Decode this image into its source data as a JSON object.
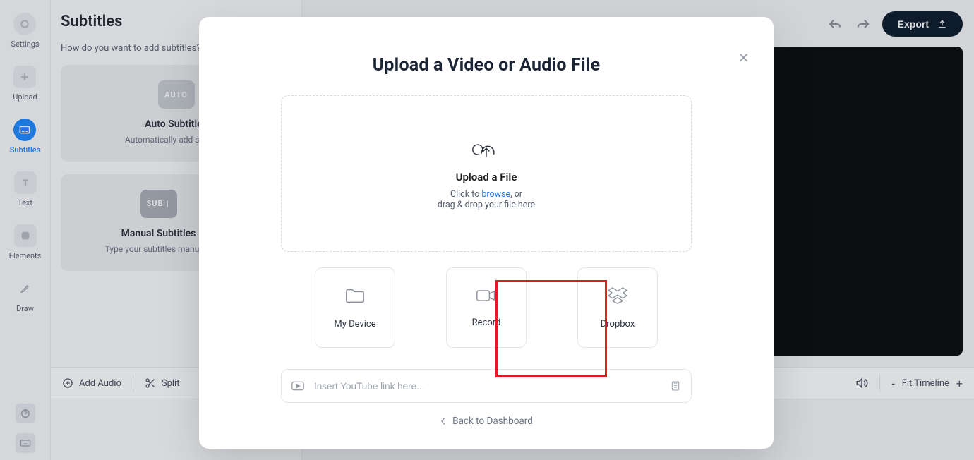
{
  "sidebar": {
    "items": [
      {
        "label": "Settings"
      },
      {
        "label": "Upload"
      },
      {
        "label": "Subtitles"
      },
      {
        "label": "Text"
      },
      {
        "label": "Elements"
      },
      {
        "label": "Draw"
      }
    ]
  },
  "panel": {
    "title": "Subtitles",
    "question": "How do you want to add subtitles?",
    "auto": {
      "badge": "AUTO",
      "title": "Auto Subtitles",
      "desc": "Automatically add subtitles"
    },
    "manual": {
      "badge": "SUB",
      "title": "Manual Subtitles",
      "desc": "Type your subtitles manually"
    },
    "upload": {
      "badge": "",
      "title": "",
      "desc": ""
    }
  },
  "toolbar": {
    "add_audio": "Add Audio",
    "split": "Split",
    "fit": "Fit Timeline"
  },
  "header": {
    "export": "Export"
  },
  "modal": {
    "title": "Upload a Video or Audio File",
    "drop_title": "Upload a File",
    "drop_prefix": "Click to ",
    "drop_link": "browse",
    "drop_suffix": ", or",
    "drop_line2": "drag & drop your file here",
    "my_device": "My Device",
    "record": "Record",
    "dropbox": "Dropbox",
    "yt_placeholder": "Insert YouTube link here...",
    "back": "Back to Dashboard"
  }
}
